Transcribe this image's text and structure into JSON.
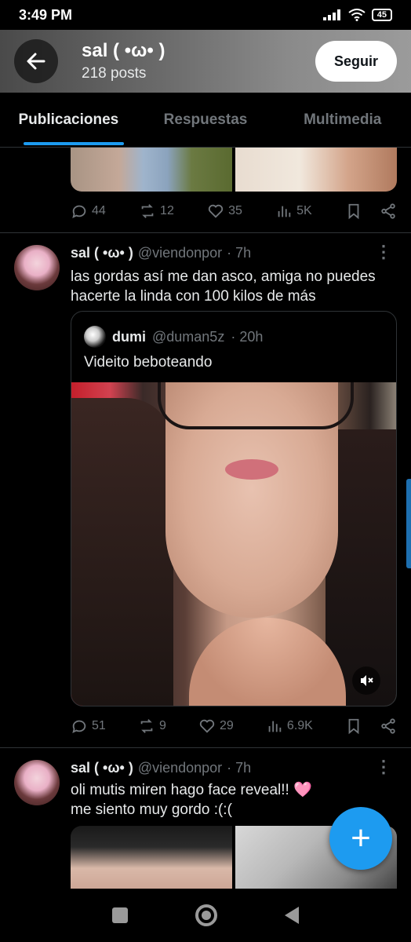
{
  "status_bar": {
    "time": "3:49 PM",
    "battery": "45"
  },
  "header": {
    "name": "sal ( •ω• )",
    "posts": "218 posts",
    "follow_label": "Seguir"
  },
  "tabs": [
    {
      "label": "Publicaciones"
    },
    {
      "label": "Respuestas"
    },
    {
      "label": "Multimedia"
    }
  ],
  "top_post": {
    "stats": {
      "replies": "44",
      "reposts": "12",
      "likes": "35",
      "views": "5K"
    }
  },
  "post1": {
    "name": "sal ( •ω• )",
    "handle": "@viendonpor",
    "time": "· 7h",
    "text": "las gordas así me dan asco, amiga no puedes hacerte la linda con 100 kilos de más",
    "quote": {
      "name": "dumi",
      "handle": "@duman5z",
      "time": "· 20h",
      "text": "Videito beboteando"
    },
    "stats": {
      "replies": "51",
      "reposts": "9",
      "likes": "29",
      "views": "6.9K"
    }
  },
  "post2": {
    "name": "sal ( •ω• )",
    "handle": "@viendonpor",
    "time": "· 7h",
    "text_line1": "oli mutis miren hago face reveal!! 🩷",
    "text_line2": "me siento muy gordo :(:("
  },
  "fab_label": "+",
  "colors": {
    "accent": "#1d9bf0",
    "muted": "#71767b",
    "divider": "#2f3336"
  }
}
